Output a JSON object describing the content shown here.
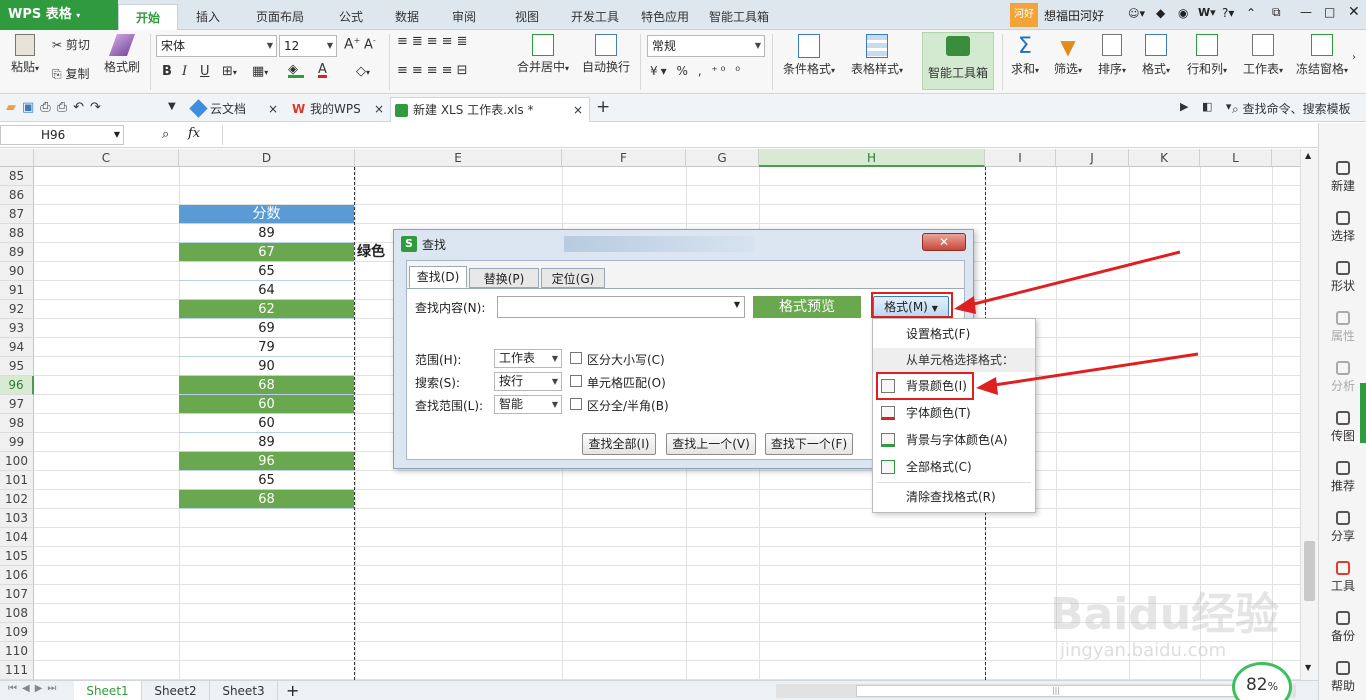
{
  "app": {
    "logo": "WPS 表格"
  },
  "ribbon_tabs": [
    "开始",
    "插入",
    "页面布局",
    "公式",
    "数据",
    "审阅",
    "视图",
    "开发工具",
    "特色应用",
    "智能工具箱"
  ],
  "user": {
    "badge": "河好",
    "name": "想福田河好"
  },
  "ribbon": {
    "paste": "粘贴",
    "cut": "剪切",
    "copy": "复制",
    "format_painter": "格式刷",
    "font_name": "宋体",
    "font_size": "12",
    "merge_center": "合并居中",
    "wrap_text": "自动换行",
    "number_format": "常规",
    "conditional_format": "条件格式",
    "table_style": "表格样式",
    "smart_toolbox": "智能工具箱",
    "sum": "求和",
    "filter": "筛选",
    "sort": "排序",
    "format": "格式",
    "row_col": "行和列",
    "worksheet": "工作表",
    "freeze": "冻结窗格"
  },
  "doc_tabs": [
    {
      "label": "云文档"
    },
    {
      "label": "我的WPS"
    },
    {
      "label": "新建 XLS 工作表.xls *"
    }
  ],
  "search_cmd": "查找命令、搜索模板",
  "name_box": "H96",
  "fx": "fx",
  "columns": [
    "C",
    "D",
    "E",
    "F",
    "G",
    "H",
    "I",
    "J",
    "K",
    "L"
  ],
  "rows": [
    "85",
    "86",
    "87",
    "88",
    "89",
    "90",
    "91",
    "92",
    "93",
    "94",
    "95",
    "96",
    "97",
    "98",
    "99",
    "100",
    "101",
    "102",
    "103",
    "104",
    "105",
    "106",
    "107",
    "108",
    "109",
    "110",
    "111"
  ],
  "header_cell": "分数",
  "scores": [
    {
      "row": "88",
      "value": "89",
      "green": false
    },
    {
      "row": "89",
      "value": "67",
      "green": true
    },
    {
      "row": "90",
      "value": "65",
      "green": false
    },
    {
      "row": "91",
      "value": "64",
      "green": false
    },
    {
      "row": "92",
      "value": "62",
      "green": true
    },
    {
      "row": "93",
      "value": "69",
      "green": false
    },
    {
      "row": "94",
      "value": "79",
      "green": false
    },
    {
      "row": "95",
      "value": "90",
      "green": false
    },
    {
      "row": "96",
      "value": "68",
      "green": true
    },
    {
      "row": "97",
      "value": "60",
      "green": true
    },
    {
      "row": "98",
      "value": "60",
      "green": false
    },
    {
      "row": "99",
      "value": "89",
      "green": false
    },
    {
      "row": "100",
      "value": "96",
      "green": true
    },
    {
      "row": "101",
      "value": "65",
      "green": false
    },
    {
      "row": "102",
      "value": "68",
      "green": true
    }
  ],
  "e89_text": "绿色",
  "dialog": {
    "title": "查找",
    "tabs": [
      "查找(D)",
      "替换(P)",
      "定位(G)"
    ],
    "find_label": "查找内容(N):",
    "find_value": "",
    "preview_label": "格式预览",
    "format_button": "格式(M)",
    "scope_label": "范围(H):",
    "scope_value": "工作表",
    "search_label": "搜索(S):",
    "search_value": "按行",
    "lookin_label": "查找范围(L):",
    "lookin_value": "智能",
    "match_case": "区分大小写(C)",
    "match_cell": "单元格匹配(O)",
    "match_width": "区分全/半角(B)",
    "find_all": "查找全部(I)",
    "find_prev": "查找上一个(V)",
    "find_next": "查找下一个(F)"
  },
  "format_menu": {
    "set_format": "设置格式(F)",
    "from_cell_header": "从单元格选择格式：",
    "bg_color": "背景颜色(I)",
    "font_color": "字体颜色(T)",
    "bg_font_color": "背景与字体颜色(A)",
    "all_format": "全部格式(C)",
    "clear_format": "清除查找格式(R)"
  },
  "sidebar": [
    "新建",
    "选择",
    "形状",
    "属性",
    "分析",
    "传图",
    "推荐",
    "分享",
    "工具",
    "备份",
    "帮助"
  ],
  "sheet_tabs": [
    "Sheet1",
    "Sheet2",
    "Sheet3"
  ],
  "zoom": "82",
  "zoom_unit": "%",
  "watermark": {
    "brand": "Baidu经验",
    "url": "jingyan.baidu.com"
  },
  "colors": {
    "brand_green": "#2f9a3e",
    "cell_green": "#6aa84f",
    "header_blue": "#5b9bd5",
    "highlight": "#e02020"
  }
}
